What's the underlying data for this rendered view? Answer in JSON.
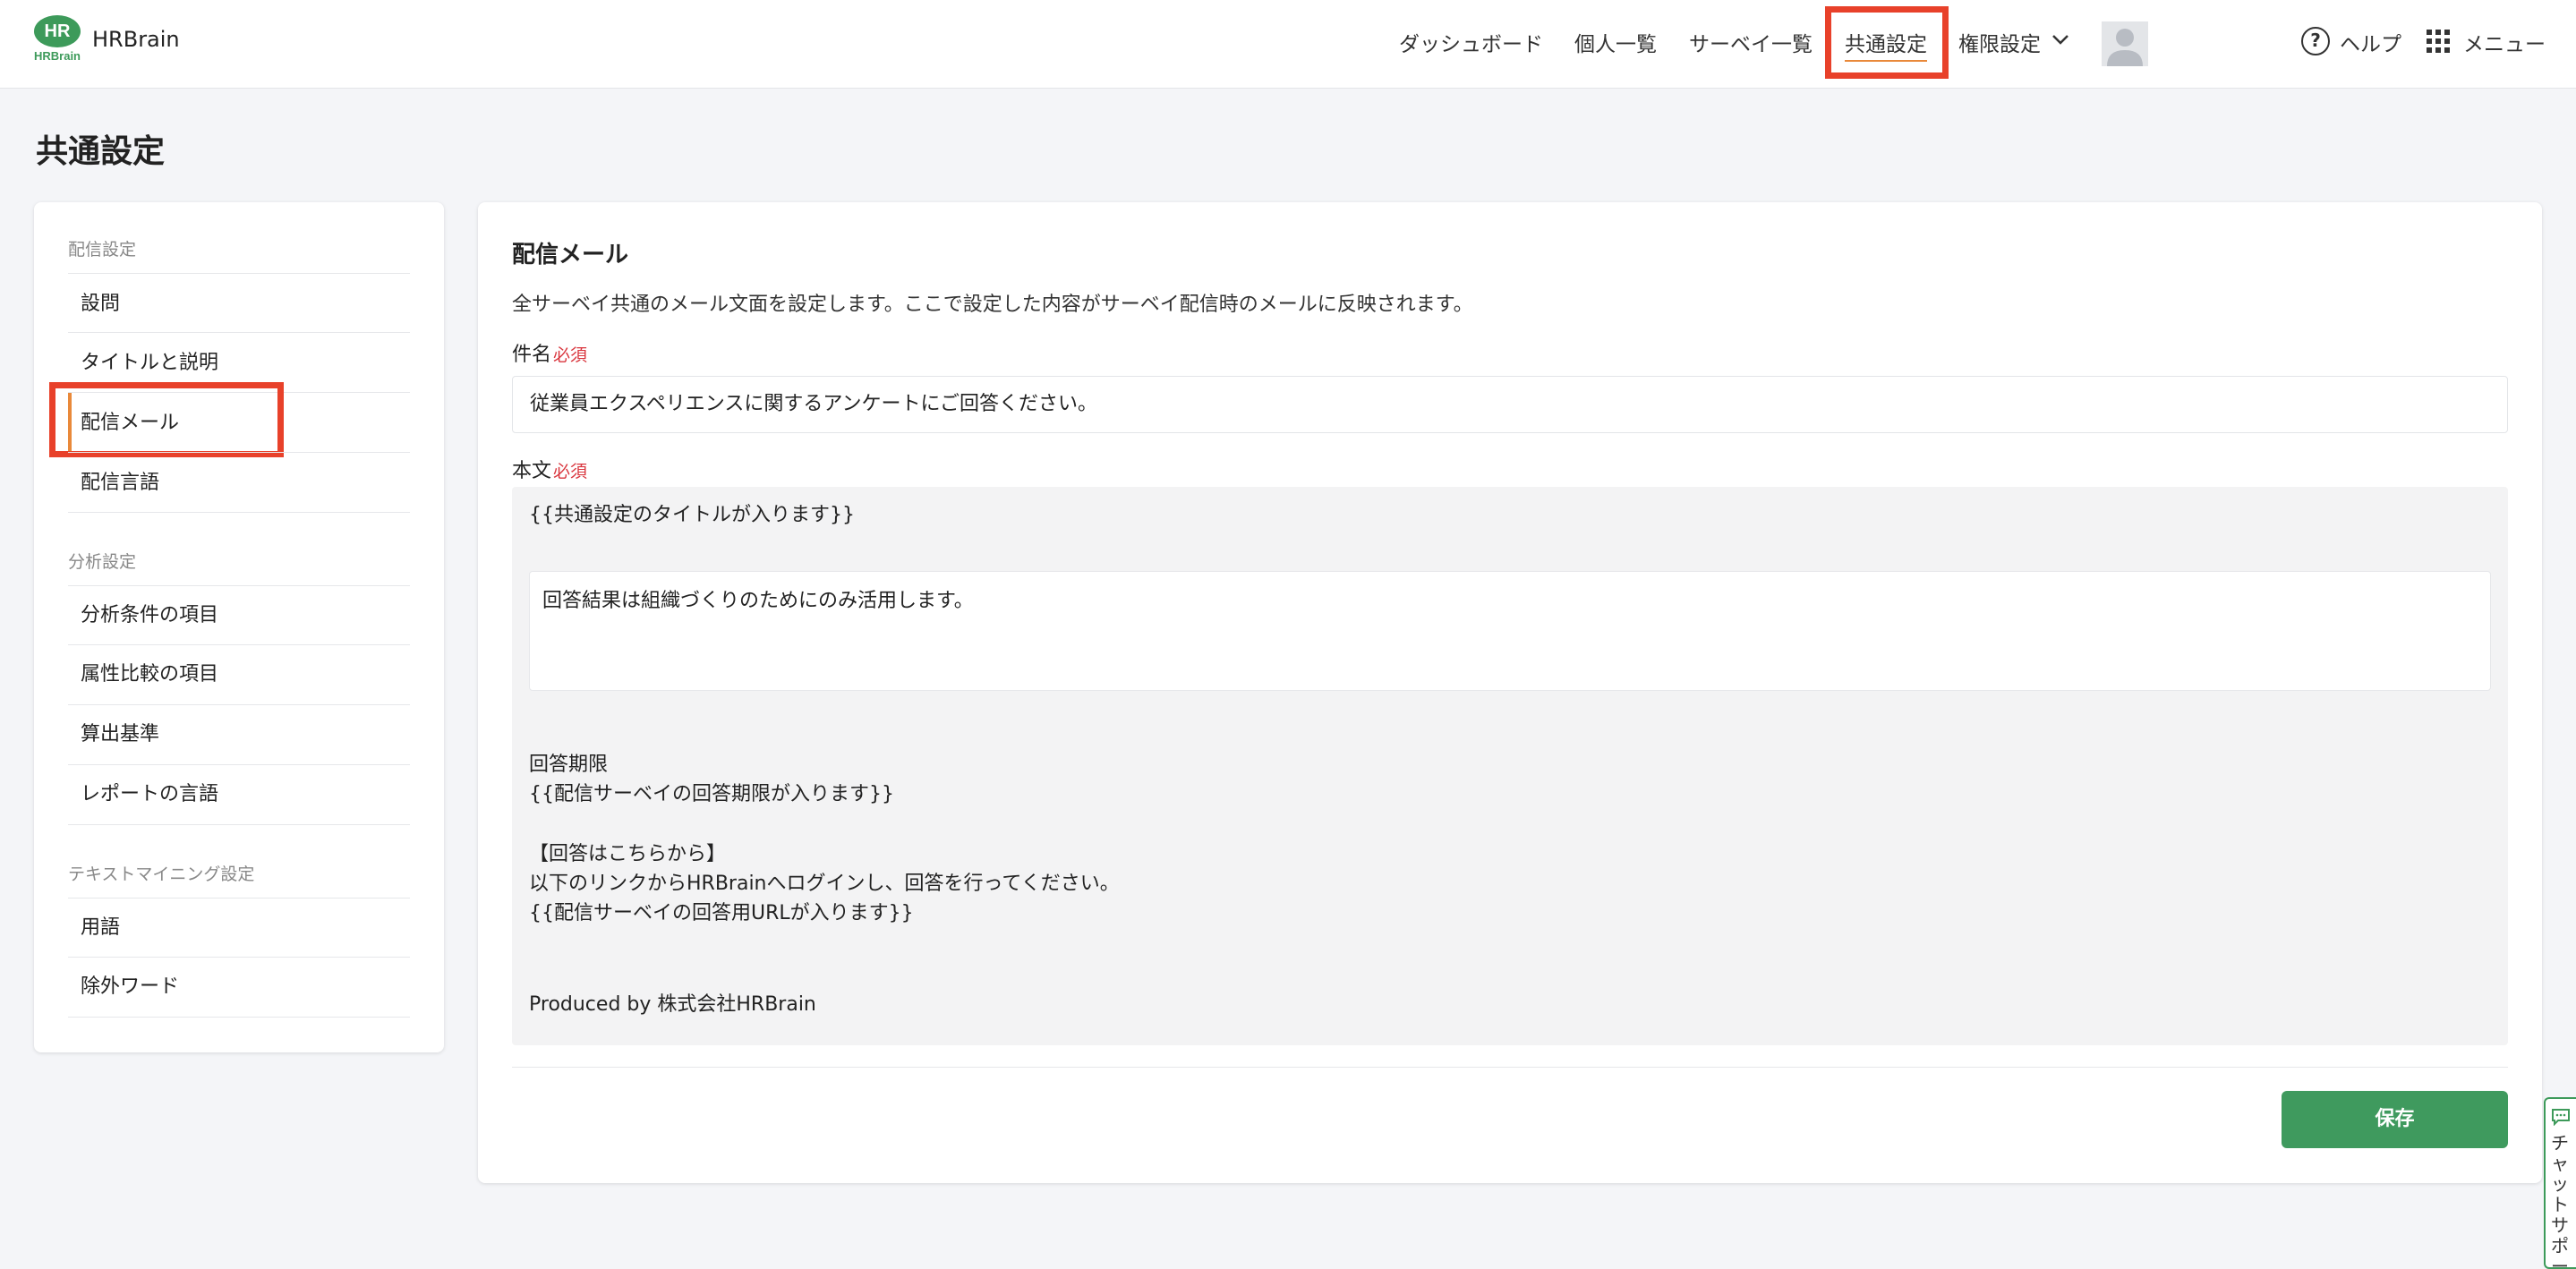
{
  "header": {
    "logo_text": "HR",
    "logo_sub": "HRBrain",
    "app_name": "HRBrain",
    "nav": [
      "ダッシュボード",
      "個人一覧",
      "サーベイ一覧",
      "共通設定",
      "権限設定"
    ],
    "active_nav": "共通設定",
    "help_label": "ヘルプ",
    "menu_label": "メニュー"
  },
  "page": {
    "title": "共通設定"
  },
  "sidebar": {
    "sections": [
      {
        "title": "配信設定",
        "items": [
          "設問",
          "タイトルと説明",
          "配信メール",
          "配信言語"
        ]
      },
      {
        "title": "分析設定",
        "items": [
          "分析条件の項目",
          "属性比較の項目",
          "算出基準",
          "レポートの言語"
        ]
      },
      {
        "title": "テキストマイニング設定",
        "items": [
          "用語",
          "除外ワード"
        ]
      }
    ],
    "active_item": "配信メール"
  },
  "panel": {
    "title": "配信メール",
    "description": "全サーベイ共通のメール文面を設定します。ここで設定した内容がサーベイ配信時のメールに反映されます。",
    "subject_label": "件名",
    "required_label": "必須",
    "subject_value": "従業員エクスペリエンスに関するアンケートにご回答ください。",
    "body_label": "本文",
    "body": {
      "title_placeholder": "{{共通設定のタイトルが入ります}}",
      "editable_text": "回答結果は組織づくりのためにのみ活用します。",
      "deadline_heading": "回答期限",
      "deadline_placeholder": "{{配信サーベイの回答期限が入ります}}",
      "answer_heading": "【回答はこちらから】",
      "answer_instruction": "以下のリンクからHRBrainへログインし、回答を行ってください。",
      "url_placeholder": "{{配信サーベイの回答用URLが入ります}}",
      "footer": "Produced by 株式会社HRBrain"
    },
    "save_label": "保存"
  },
  "chat_tab": {
    "label": "チャットサポート"
  },
  "colors": {
    "brand_green": "#3d9a5a",
    "highlight_red": "#e8412a",
    "active_accent": "#e9893a",
    "required_red": "#d9363e"
  },
  "icons": [
    "help-circle-icon",
    "grid-menu-icon",
    "chevron-down-icon",
    "avatar-icon",
    "chat-icon"
  ]
}
